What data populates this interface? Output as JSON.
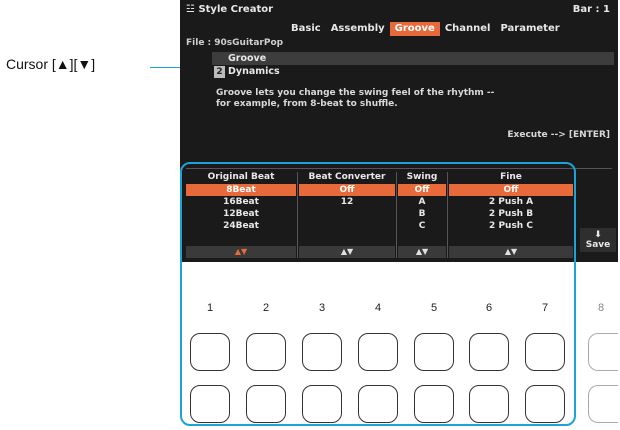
{
  "callout": {
    "label": "Cursor [▲][▼]"
  },
  "header": {
    "title": "Style Creator",
    "bar_label": "Bar :",
    "bar_value": "1"
  },
  "tabs": [
    {
      "label": "Basic",
      "active": false
    },
    {
      "label": "Assembly",
      "active": false
    },
    {
      "label": "Groove",
      "active": true
    },
    {
      "label": "Channel",
      "active": false
    },
    {
      "label": "Parameter",
      "active": false
    }
  ],
  "file": {
    "label": "File : 90sGuitarPop"
  },
  "menu": [
    {
      "num": "1",
      "label": "Groove"
    },
    {
      "num": "2",
      "label": "Dynamics"
    }
  ],
  "description": {
    "line1": "Groove lets you change the swing feel of the rhythm --",
    "line2": "for example, from 8-beat to shuffle."
  },
  "execute": "Execute --> [ENTER]",
  "columns": [
    {
      "title": "Original Beat",
      "values": [
        "8Beat",
        "16Beat",
        "12Beat",
        "24Beat"
      ],
      "arrows": "▲▼"
    },
    {
      "title": "Beat Converter",
      "values": [
        "Off",
        "12",
        "",
        ""
      ],
      "arrows": "▲▼"
    },
    {
      "title": "Swing",
      "values": [
        "Off",
        "A",
        "B",
        "C"
      ],
      "arrows": "▲▼"
    },
    {
      "title": "Fine",
      "values": [
        "Off",
        "2 Push A",
        "2 Push B",
        "2 Push C"
      ],
      "arrows": "▲▼"
    }
  ],
  "save": {
    "label": "Save",
    "icon": "save-icon"
  },
  "buttons": {
    "numbers": [
      "1",
      "2",
      "3",
      "4",
      "5",
      "6",
      "7",
      "8"
    ]
  },
  "colors": {
    "accent": "#e86a3a",
    "callout": "#1aa3d6",
    "screen": "#1a1a1a"
  }
}
